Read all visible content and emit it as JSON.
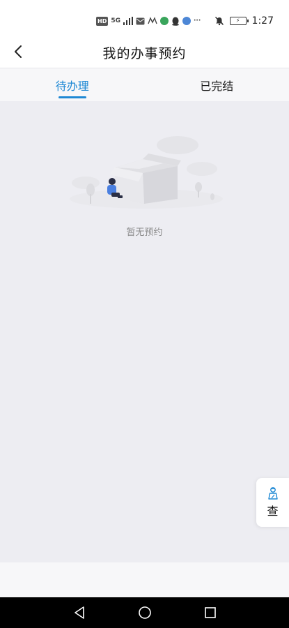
{
  "status_bar": {
    "time": "1:27",
    "network_hd": "HD",
    "network_5g": "5G",
    "battery_label": "⚡"
  },
  "header": {
    "title": "我的办事预约"
  },
  "tabs": [
    {
      "label": "待办理",
      "active": true
    },
    {
      "label": "已完结",
      "active": false
    }
  ],
  "empty_state": {
    "message": "暂无预约"
  },
  "float_button": {
    "label": "查"
  },
  "colors": {
    "accent": "#1e88d4",
    "background": "#ededf2"
  }
}
